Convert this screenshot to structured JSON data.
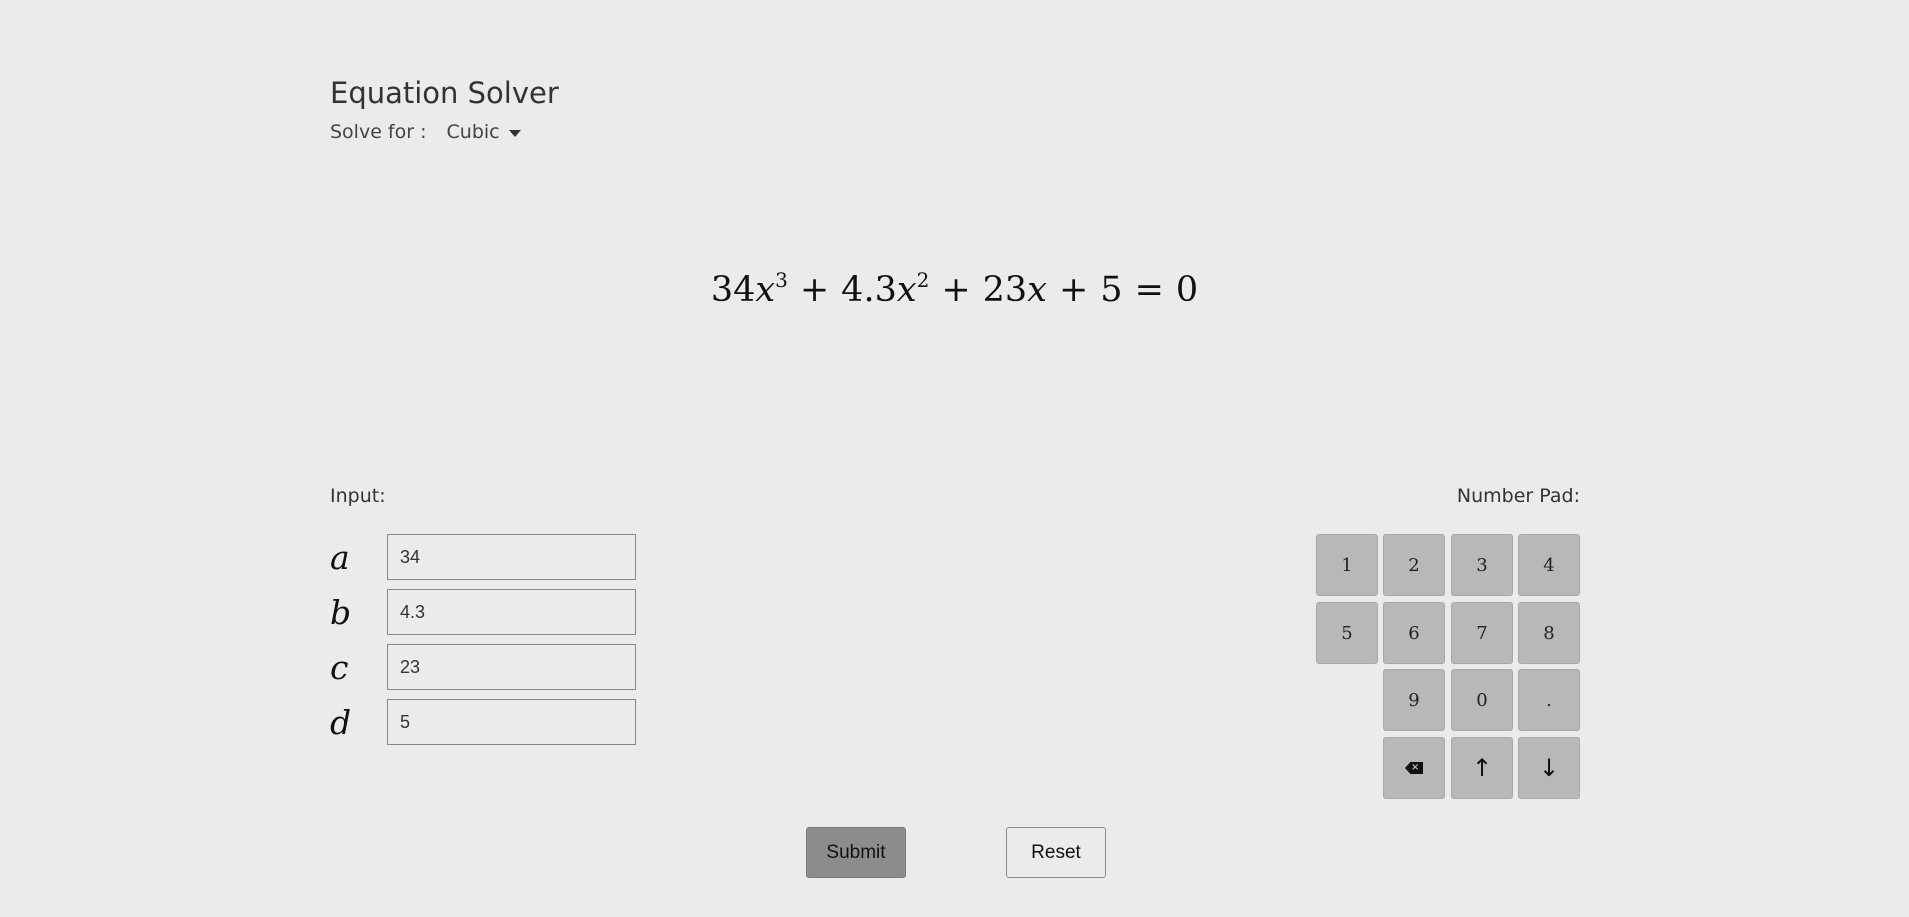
{
  "header": {
    "title": "Equation Solver",
    "solve_for_label": "Solve for :",
    "solve_for_value": "Cubic"
  },
  "equation": {
    "a": "34",
    "b": "4.3",
    "c": "23",
    "d": "5",
    "variable": "x",
    "exp_a": "3",
    "exp_b": "2",
    "plus": "+",
    "equals": "=",
    "rhs": "0"
  },
  "input": {
    "label": "Input:",
    "fields": [
      {
        "name": "a",
        "value": "34"
      },
      {
        "name": "b",
        "value": "4.3"
      },
      {
        "name": "c",
        "value": "23"
      },
      {
        "name": "d",
        "value": "5"
      }
    ]
  },
  "number_pad": {
    "label": "Number Pad:",
    "keys": [
      "1",
      "2",
      "3",
      "4",
      "5",
      "6",
      "7",
      "8",
      "9",
      "0",
      "."
    ],
    "icons": {
      "backspace": "backspace-icon",
      "up": "arrow-up-icon",
      "down": "arrow-down-icon"
    }
  },
  "actions": {
    "submit_label": "Submit",
    "reset_label": "Reset"
  },
  "colors": {
    "background": "#ebebeb",
    "key_background": "#b8b8b8",
    "submit_background": "#8c8c8c"
  }
}
